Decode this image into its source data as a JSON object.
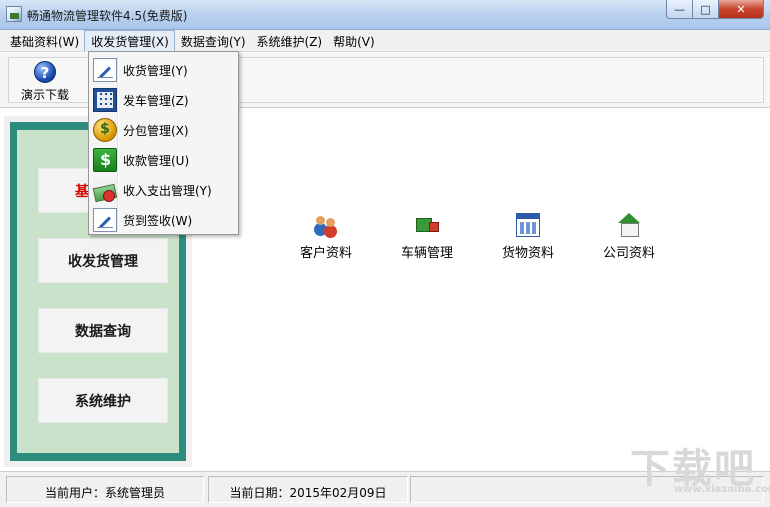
{
  "window": {
    "title": "畅通物流管理软件4.5(免费版)"
  },
  "menubar": [
    {
      "label": "基础资料(W)"
    },
    {
      "label": "收发货管理(X)"
    },
    {
      "label": "数据查询(Y)"
    },
    {
      "label": "系统维护(Z)"
    },
    {
      "label": "帮助(V)"
    }
  ],
  "toolbar": {
    "demo_download_label": "演示下载"
  },
  "dropdown": {
    "items": [
      {
        "label": "收货管理(Y)",
        "icon": "edit-pen-icon"
      },
      {
        "label": "发车管理(Z)",
        "icon": "grid-calendar-icon"
      },
      {
        "label": "分包管理(X)",
        "icon": "coins-icon"
      },
      {
        "label": "收款管理(U)",
        "icon": "dollar-icon"
      },
      {
        "label": "收入支出管理(Y)",
        "icon": "money-icon"
      },
      {
        "label": "货到签收(W)",
        "icon": "sign-pen-icon"
      }
    ]
  },
  "sidebar": {
    "items": [
      {
        "label": "基础资料",
        "state": "current"
      },
      {
        "label": "收发货管理"
      },
      {
        "label": "数据查询"
      },
      {
        "label": "系统维护"
      }
    ]
  },
  "content": {
    "tiles": [
      {
        "label": "客户资料",
        "icon": "customers-icon"
      },
      {
        "label": "车辆管理",
        "icon": "truck-icon"
      },
      {
        "label": "货物资料",
        "icon": "goods-table-icon"
      },
      {
        "label": "公司资料",
        "icon": "company-house-icon"
      }
    ]
  },
  "statusbar": {
    "user": "当前用户：系统管理员",
    "date": "当前日期：2015年02月09日"
  },
  "watermark": {
    "text": "下载吧",
    "url": "www.xiazaiba.com"
  }
}
